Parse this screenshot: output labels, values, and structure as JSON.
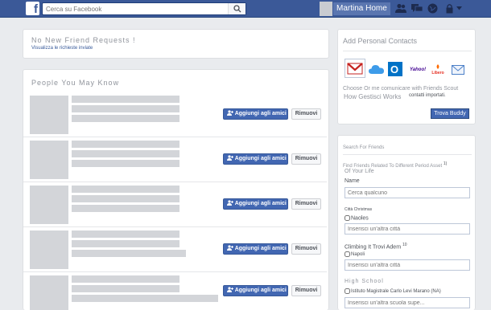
{
  "topbar": {
    "logo": "f",
    "search_placeholder": "Cerca su Facebook",
    "profile_name": "Martina Home"
  },
  "friend_requests": {
    "title": "No New Friend Requests !",
    "link": "Visualizza le richieste inviate"
  },
  "pymk": {
    "title": "People You May Know",
    "add_label": "Aggiungi agli amici",
    "remove_label": "Rimuovi"
  },
  "contacts": {
    "title": "Add Personal Contacts",
    "services": [
      "Gmail",
      "iCloud",
      "Outlook",
      "Yahoo!",
      "Libero",
      "Email"
    ],
    "desc_1": "Choose Or me comunicare with Friends Scout",
    "desc_2": "How Gestisci Works",
    "desc_3": "contatti importati.",
    "button": "Trova Buddy"
  },
  "search_friends": {
    "title": "Search For Friends",
    "subtitle_1": "Find Friends Related To Different Period Asset",
    "subtitle_sup": "1)",
    "subtitle_2": "Of Your Life",
    "name_label": "Name",
    "name_placeholder": "Cerca qualcuno",
    "city_label": "Città Christmas",
    "city_check": "Naoles",
    "city_placeholder": "Inserisci un'altra città",
    "current_label": "Climbing It Trovi Adem",
    "current_sup": "10",
    "current_check": "Napoli",
    "current_placeholder": "Inserisci un'altra città",
    "school_label": "High School",
    "school_check": "Istituto Magistrale Carlo Levi Marano (NA)",
    "school_placeholder": "Inserisci un'altra scuola supe..."
  }
}
